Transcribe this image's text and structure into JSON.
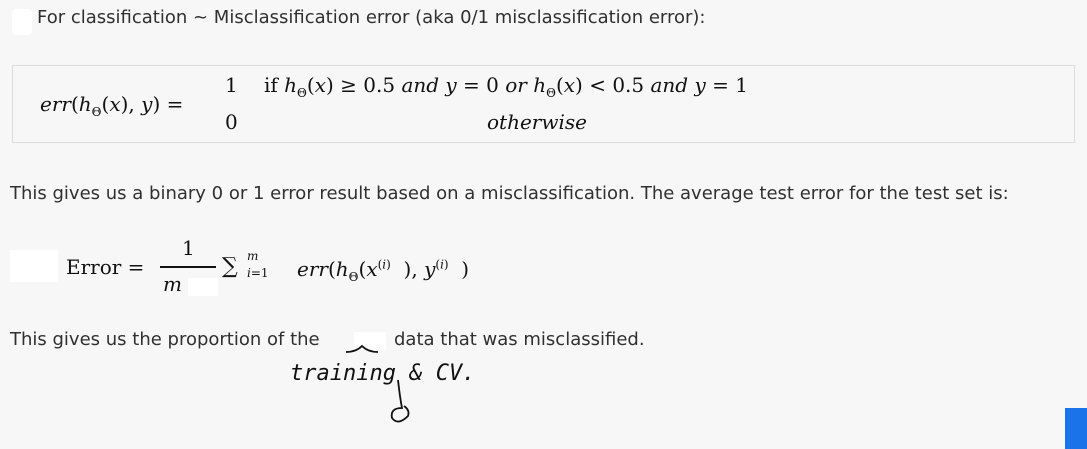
{
  "intro": {
    "text": "For classification ~ Misclassification error (aka 0/1 misclassification error):"
  },
  "formula1": {
    "lhs": "err(hΘ(x), y) =",
    "case1_value": "1",
    "case1_condition": "if hΘ(x) ≥ 0.5 and y = 0 or hΘ(x) < 0.5 and y = 1",
    "case2_value": "0",
    "case2_condition": "otherwise"
  },
  "paragraph1": "This gives us a binary 0 or 1 error result based on a misclassification. The average test error for the test set is:",
  "formula2": {
    "lhs": "Error =",
    "numerator": "1",
    "denominator": "m",
    "sum_symbol": "∑",
    "sum_upper": "m",
    "sum_lower": "i=1",
    "body": "err(hΘ(x(i)), y(i))"
  },
  "paragraph2": {
    "before": "This gives us the proportion of the",
    "after": "data that was misclassified."
  },
  "annotation": {
    "handwritten": "training & CV.",
    "color": "#111111"
  },
  "colors": {
    "background": "#f7f7f7",
    "text": "#303030",
    "accent": "#1a73e8"
  }
}
